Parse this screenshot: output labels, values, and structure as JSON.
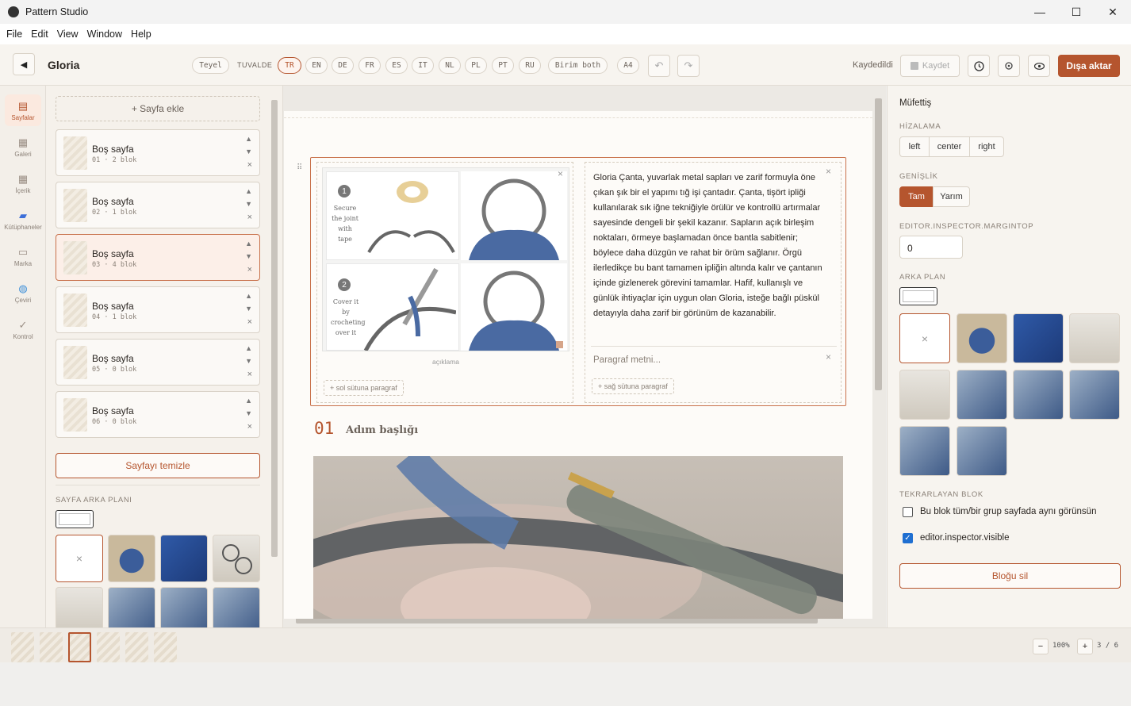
{
  "window": {
    "title": "Pattern Studio",
    "controls": [
      "—",
      "☐",
      "✕"
    ]
  },
  "menu": [
    "File",
    "Edit",
    "View",
    "Window",
    "Help"
  ],
  "toolbar": {
    "back_icon": "◀",
    "project_name": "Gloria",
    "teyel": "Teyel",
    "tuvalde_label": "TUVALDE",
    "languages": [
      "TR",
      "EN",
      "DE",
      "FR",
      "ES",
      "IT",
      "NL",
      "PL",
      "PT",
      "RU"
    ],
    "active_language": "TR",
    "unit": "Birim both",
    "paper": "A4",
    "undo": "↶",
    "redo": "↷",
    "saved_status": "Kaydedildi",
    "save_label": "Kaydet",
    "export_label": "Dışa aktar",
    "accent": "#b5552e"
  },
  "rail": [
    {
      "label": "Sayfalar",
      "icon": "▤"
    },
    {
      "label": "Galeri",
      "icon": "▦"
    },
    {
      "label": "İçerik",
      "icon": "▦"
    },
    {
      "label": "Kütüphaneler",
      "icon": "▮"
    },
    {
      "label": "Marka",
      "icon": "▭"
    },
    {
      "label": "Çeviri",
      "icon": "◍"
    },
    {
      "label": "Kontrol",
      "icon": "✓"
    }
  ],
  "pages_panel": {
    "add_page": "+ Sayfa ekle",
    "pages": [
      {
        "name": "Boş sayfa",
        "meta": "01 · 2 blok"
      },
      {
        "name": "Boş sayfa",
        "meta": "02 · 1 blok"
      },
      {
        "name": "Boş sayfa",
        "meta": "03 · 4 blok"
      },
      {
        "name": "Boş sayfa",
        "meta": "04 · 1 blok"
      },
      {
        "name": "Boş sayfa",
        "meta": "05 · 0 blok"
      },
      {
        "name": "Boş sayfa",
        "meta": "06 · 0 blok"
      }
    ],
    "selected_page": 3,
    "clear_page": "Sayfayı temizle",
    "background_label": "SAYFA ARKA PLANI"
  },
  "canvas": {
    "tutorial_steps": [
      {
        "num": "1",
        "text": "Secure the joint with tape"
      },
      {
        "num": "2",
        "text": "Cover it by crocheting over it"
      }
    ],
    "caption": "açıklama",
    "left_add": "+ sol sütuna paragraf",
    "right_add": "+ sağ sütuna paragraf",
    "paragraph": "Gloria Çanta, yuvarlak metal sapları ve zarif formuyla öne çıkan şık bir el yapımı tığ işi çantadır. Çanta, tişört ipliği kullanılarak sık iğne tekniğiyle örülür ve kontrollü artırmalar sayesinde dengeli bir şekil kazanır. Sapların açık birleşim noktaları, örmeye başlamadan önce bantla sabitlenir; böylece daha düzgün ve rahat bir örüm sağlanır. Örgü ilerledikçe bu bant tamamen ipliğin altında kalır ve çantanın içinde gizlenerek görevini tamamlar. Hafif, kullanışlı ve günlük ihtiyaçlar için uygun olan Gloria, isteğe bağlı püskül detayıyla daha zarif bir görünüm de kazanabilir.",
    "paragraph_placeholder": "Paragraf metni...",
    "step_number": "01",
    "step_title": "Adım başlığı"
  },
  "inspector": {
    "title": "Müfettiş",
    "align_label": "HİZALAMA",
    "align_options": [
      "left",
      "center",
      "right"
    ],
    "width_label": "GENİŞLİK",
    "width_options": [
      "Tam",
      "Yarım"
    ],
    "width_selected": "Tam",
    "margin_label": "EDITOR.INSPECTOR.MARGINTOP",
    "margin_value": "0",
    "bg_label": "ARKA PLAN",
    "repeat_label": "TEKRARLAYAN BLOK",
    "repeat_checkbox": "Bu blok tüm/bir grup sayfada aynı görünsün",
    "repeat_checked": false,
    "visible_checkbox": "editor.inspector.visible",
    "visible_checked": true,
    "delete_block": "Bloğu sil"
  },
  "statusbar": {
    "zoom_out": "−",
    "zoom": "100%",
    "zoom_in": "+",
    "page_indicator": "3 / 6"
  }
}
